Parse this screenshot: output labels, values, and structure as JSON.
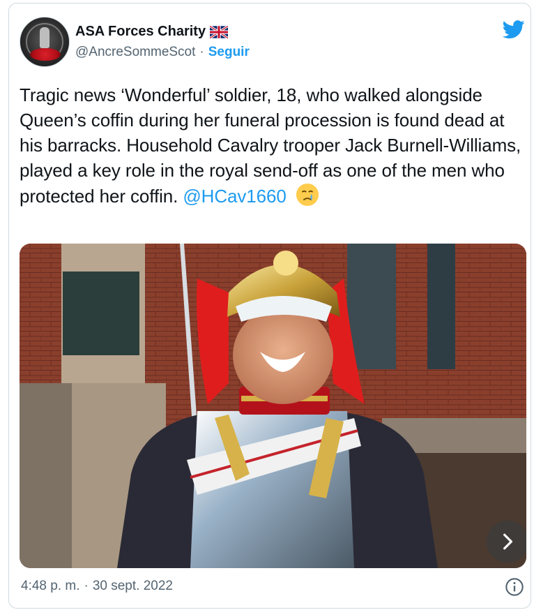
{
  "author": {
    "display_name": "ASA Forces Charity",
    "flag_icon": "uk-flag-icon",
    "handle": "@AncreSommeScot",
    "separator": "·",
    "follow_label": "Seguir",
    "avatar_icon": "poppy-avatar-icon"
  },
  "tweet": {
    "text": "Tragic news ‘Wonderful’ soldier, 18, who walked alongside Queen’s coffin during her funeral procession is found dead at his barracks. Household Cavalry trooper Jack Burnell-Williams, played a key role in the royal send-off as one of the men who protected her coffin.",
    "mention": "@HCav1660",
    "emoji_icon": "crying-face-icon"
  },
  "media": {
    "photo_icon": "soldier-photo",
    "next_icon": "chevron-right-icon"
  },
  "footer": {
    "time": "4:48 p. m.",
    "separator": "·",
    "date": "30 sept. 2022",
    "info_icon": "info-icon"
  },
  "colors": {
    "accent": "#1d9bf0",
    "text": "#0f1419",
    "muted": "#536471",
    "border": "#cfd9de"
  }
}
